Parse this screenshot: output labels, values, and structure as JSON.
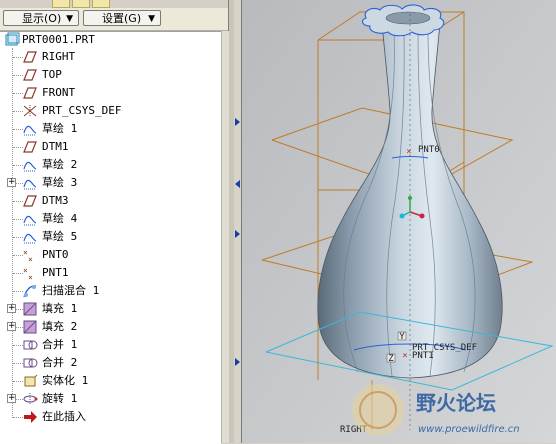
{
  "toolbar": {
    "show_menu": "显示(O)",
    "settings_menu": "设置(G)",
    "dropdown_glyph": "▼"
  },
  "model_tree": {
    "root": "PRT0001.PRT",
    "items": [
      {
        "label": "RIGHT",
        "icon": "datum-plane-icon",
        "expandable": false
      },
      {
        "label": "TOP",
        "icon": "datum-plane-icon",
        "expandable": false
      },
      {
        "label": "FRONT",
        "icon": "datum-plane-icon",
        "expandable": false
      },
      {
        "label": "PRT_CSYS_DEF",
        "icon": "csys-icon",
        "expandable": false
      },
      {
        "label": "草绘 1",
        "icon": "sketch-icon",
        "expandable": false
      },
      {
        "label": "DTM1",
        "icon": "datum-plane-icon",
        "expandable": false
      },
      {
        "label": "草绘 2",
        "icon": "sketch-icon",
        "expandable": false
      },
      {
        "label": "草绘 3",
        "icon": "sketch-icon",
        "expandable": true
      },
      {
        "label": "DTM3",
        "icon": "datum-plane-icon",
        "expandable": false
      },
      {
        "label": "草绘 4",
        "icon": "sketch-icon",
        "expandable": false
      },
      {
        "label": "草绘 5",
        "icon": "sketch-icon",
        "expandable": false
      },
      {
        "label": "PNT0",
        "icon": "datum-point-icon",
        "expandable": false
      },
      {
        "label": "PNT1",
        "icon": "datum-point-icon",
        "expandable": false
      },
      {
        "label": "扫描混合 1",
        "icon": "swept-blend-icon",
        "expandable": false
      },
      {
        "label": "填充 1",
        "icon": "fill-icon",
        "expandable": true
      },
      {
        "label": "填充 2",
        "icon": "fill-icon",
        "expandable": true
      },
      {
        "label": "合并 1",
        "icon": "merge-icon",
        "expandable": false
      },
      {
        "label": "合并 2",
        "icon": "merge-icon",
        "expandable": false
      },
      {
        "label": "实体化 1",
        "icon": "solidify-icon",
        "expandable": false
      },
      {
        "label": "旋转 1",
        "icon": "revolve-icon",
        "expandable": true
      },
      {
        "label": "在此插入",
        "icon": "insert-here-arrow-icon",
        "expandable": false
      }
    ]
  },
  "viewport": {
    "labels": {
      "pnt0": "PNT0",
      "csys": "PRT_CSYS_DEF",
      "pnt1": "PNT1",
      "right": "RIGHT",
      "axis_y": "Y",
      "axis_z": "Z"
    },
    "colors": {
      "datum_plane_orange": "#c07a28",
      "datum_plane_cyan": "#3ab8d8",
      "sketch_blue": "#2b5fd8",
      "point_red": "#c03030"
    },
    "watermark": {
      "title": "野火论坛",
      "url": "www.proewildfire.cn"
    }
  }
}
